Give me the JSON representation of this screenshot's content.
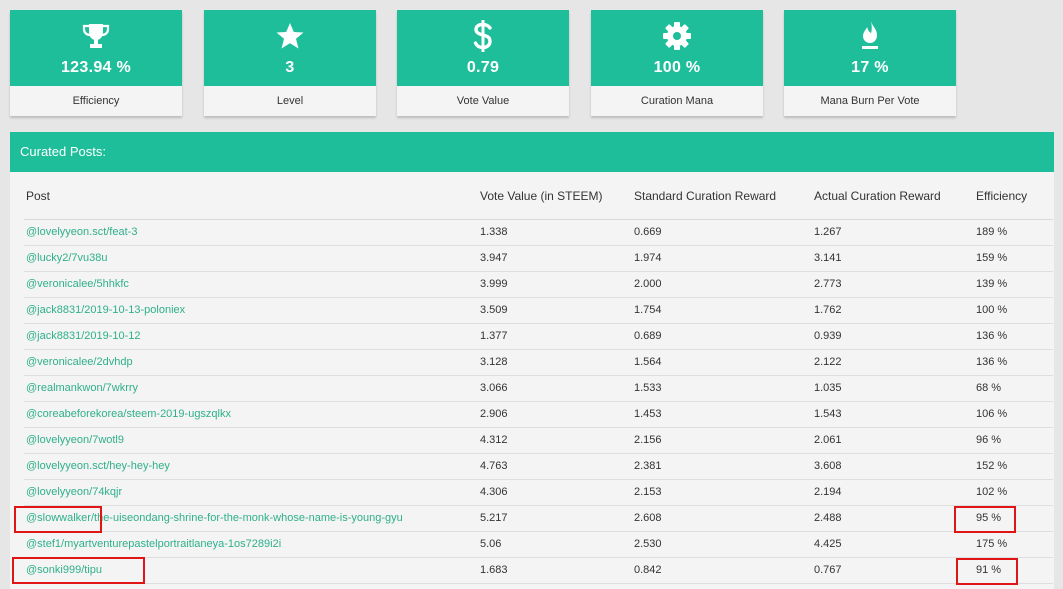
{
  "stats": [
    {
      "icon": "trophy-icon",
      "value": "123.94 %",
      "label": "Efficiency"
    },
    {
      "icon": "star-icon",
      "value": "3",
      "label": "Level"
    },
    {
      "icon": "dollar-icon",
      "value": "0.79",
      "label": "Vote Value"
    },
    {
      "icon": "gear-icon",
      "value": "100 %",
      "label": "Curation Mana"
    },
    {
      "icon": "fire-icon",
      "value": "17 %",
      "label": "Mana Burn Per Vote"
    }
  ],
  "curated": {
    "title": "Curated Posts:",
    "columns": [
      "Post",
      "Vote Value (in STEEM)",
      "Standard Curation Reward",
      "Actual Curation Reward",
      "Efficiency"
    ],
    "rows": [
      {
        "post": "@lovelyyeon.sct/feat-3",
        "vote": "1.338",
        "standard": "0.669",
        "actual": "1.267",
        "efficiency": "189 %"
      },
      {
        "post": "@lucky2/7vu38u",
        "vote": "3.947",
        "standard": "1.974",
        "actual": "3.141",
        "efficiency": "159 %"
      },
      {
        "post": "@veronicalee/5hhkfc",
        "vote": "3.999",
        "standard": "2.000",
        "actual": "2.773",
        "efficiency": "139 %"
      },
      {
        "post": "@jack8831/2019-10-13-poloniex",
        "vote": "3.509",
        "standard": "1.754",
        "actual": "1.762",
        "efficiency": "100 %"
      },
      {
        "post": "@jack8831/2019-10-12",
        "vote": "1.377",
        "standard": "0.689",
        "actual": "0.939",
        "efficiency": "136 %"
      },
      {
        "post": "@veronicalee/2dvhdp",
        "vote": "3.128",
        "standard": "1.564",
        "actual": "2.122",
        "efficiency": "136 %"
      },
      {
        "post": "@realmankwon/7wkrry",
        "vote": "3.066",
        "standard": "1.533",
        "actual": "1.035",
        "efficiency": "68 %"
      },
      {
        "post": "@coreabeforekorea/steem-2019-ugszqlkx",
        "vote": "2.906",
        "standard": "1.453",
        "actual": "1.543",
        "efficiency": "106 %"
      },
      {
        "post": "@lovelyyeon/7wotl9",
        "vote": "4.312",
        "standard": "2.156",
        "actual": "2.061",
        "efficiency": "96 %"
      },
      {
        "post": "@lovelyyeon.sct/hey-hey-hey",
        "vote": "4.763",
        "standard": "2.381",
        "actual": "3.608",
        "efficiency": "152 %"
      },
      {
        "post": "@lovelyyeon/74kqjr",
        "vote": "4.306",
        "standard": "2.153",
        "actual": "2.194",
        "efficiency": "102 %"
      },
      {
        "post": "@slowwalker/the-uiseondang-shrine-for-the-monk-whose-name-is-young-gyu",
        "vote": "5.217",
        "standard": "2.608",
        "actual": "2.488",
        "efficiency": "95 %"
      },
      {
        "post": "@stef1/myartventurepastelportraitlaneya-1os7289i2i",
        "vote": "5.06",
        "standard": "2.530",
        "actual": "4.425",
        "efficiency": "175 %"
      },
      {
        "post": "@sonki999/tipu",
        "vote": "1.683",
        "standard": "0.842",
        "actual": "0.767",
        "efficiency": "91 %"
      }
    ]
  },
  "colors": {
    "accent": "#1ebe9b",
    "link": "#2fb08a",
    "highlight": "#e01515"
  }
}
